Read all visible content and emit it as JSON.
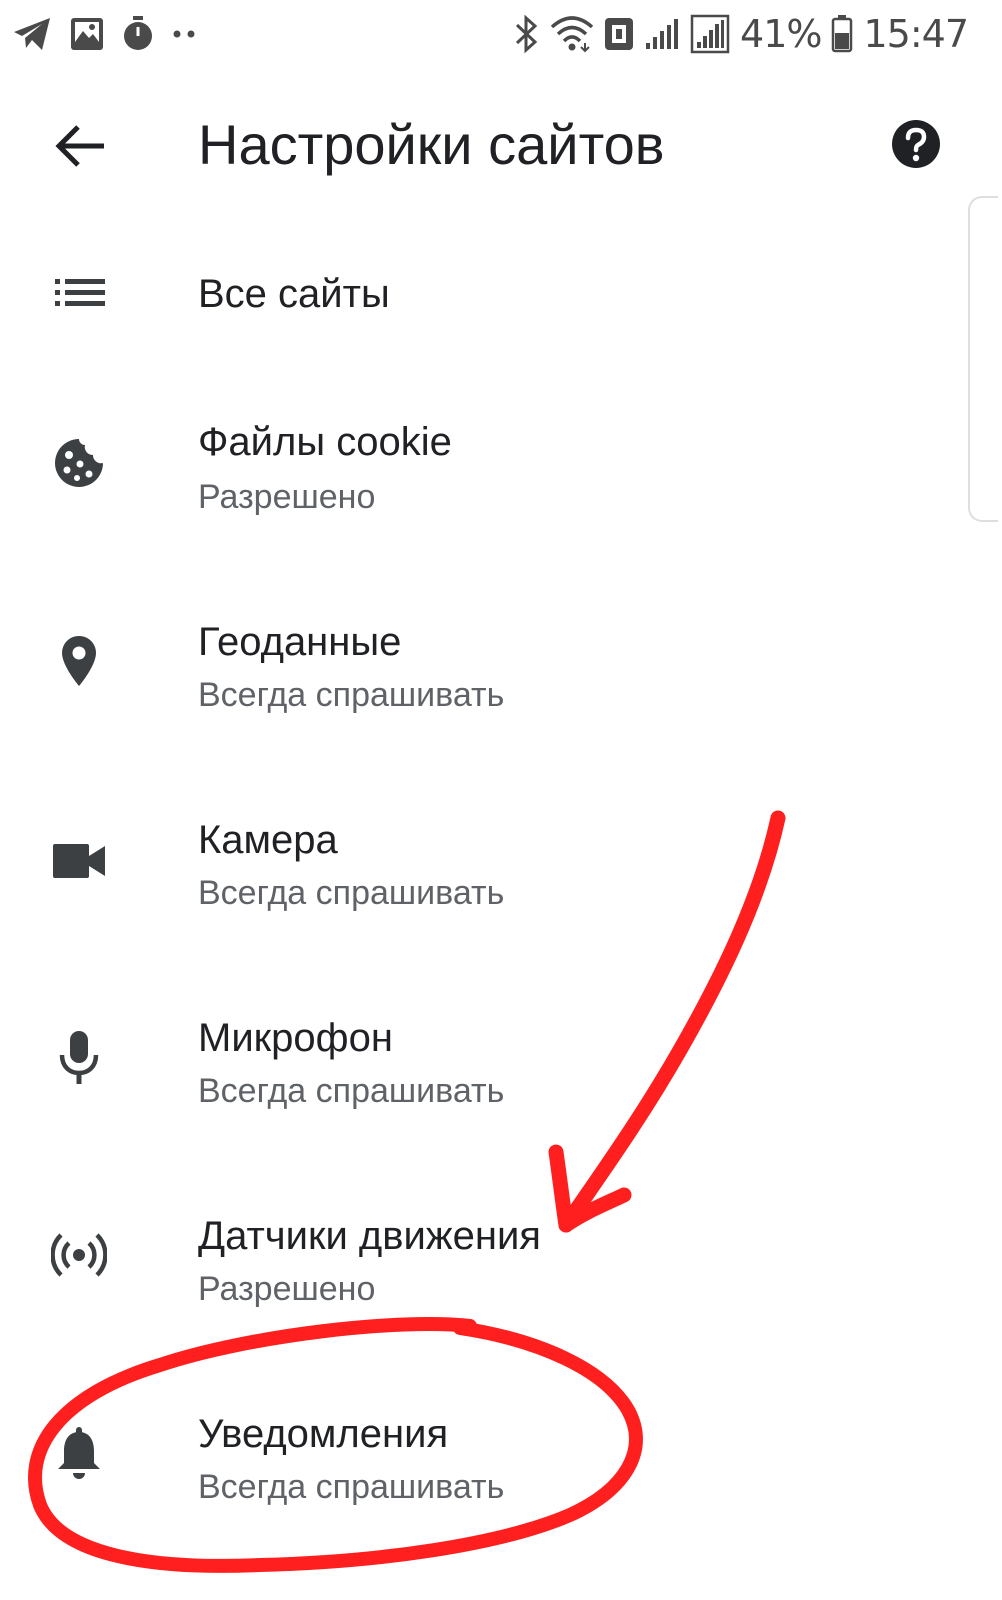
{
  "status_bar": {
    "left_icons": [
      "telegram-icon",
      "gallery-icon",
      "stopwatch-icon",
      "more-dots-icon"
    ],
    "right_icons": [
      "bluetooth-icon",
      "wifi-icon",
      "nfc-icon",
      "signal-icon",
      "signal-icon",
      "battery-icon"
    ],
    "battery": "41%",
    "time": "15:47"
  },
  "app_bar": {
    "title": "Настройки сайтов",
    "back_icon": "arrow-back-icon",
    "help_icon": "help-icon"
  },
  "settings": {
    "items": [
      {
        "icon": "list-icon",
        "title": "Все сайты",
        "subtitle": ""
      },
      {
        "icon": "cookie-icon",
        "title": "Файлы cookie",
        "subtitle": "Разрешено"
      },
      {
        "icon": "location-pin-icon",
        "title": "Геоданные",
        "subtitle": "Всегда спрашивать"
      },
      {
        "icon": "videocam-icon",
        "title": "Камера",
        "subtitle": "Всегда спрашивать"
      },
      {
        "icon": "microphone-icon",
        "title": "Микрофон",
        "subtitle": "Всегда спрашивать"
      },
      {
        "icon": "motion-sensor-icon",
        "title": "Датчики движения",
        "subtitle": "Разрешено"
      },
      {
        "icon": "bell-icon",
        "title": "Уведомления",
        "subtitle": "Всегда спрашивать"
      }
    ]
  },
  "colors": {
    "title_text": "#202124",
    "subtitle_text": "#5f6368",
    "icon": "#3c4043",
    "annotation_red": "#ff1f1f"
  }
}
